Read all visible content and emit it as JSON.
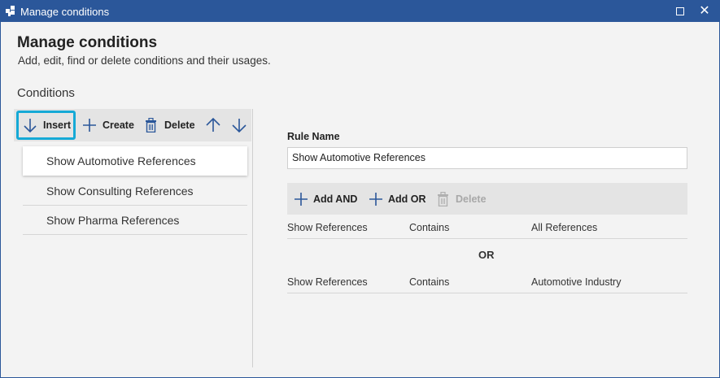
{
  "window": {
    "title": "Manage conditions",
    "controls": {
      "maximize": "maximize-icon",
      "close": "close-icon"
    }
  },
  "header": {
    "title": "Manage conditions",
    "subtitle": "Add, edit, find or delete conditions and their usages."
  },
  "conditions": {
    "section_label": "Conditions",
    "toolbar": {
      "insert_label": "Insert",
      "create_label": "Create",
      "delete_label": "Delete"
    },
    "items": [
      {
        "label": "Show Automotive References",
        "selected": true
      },
      {
        "label": "Show Consulting References",
        "selected": false
      },
      {
        "label": "Show Pharma References",
        "selected": false
      }
    ]
  },
  "rule": {
    "name_label": "Rule Name",
    "name_value": "Show Automotive References",
    "toolbar": {
      "add_and_label": "Add AND",
      "add_or_label": "Add OR",
      "delete_label": "Delete"
    },
    "groups": [
      {
        "field": "Show References",
        "operator": "Contains",
        "value": "All References"
      },
      {
        "field": "Show References",
        "operator": "Contains",
        "value": "Automotive Industry"
      }
    ],
    "or_separator": "OR"
  },
  "colors": {
    "titlebar": "#2b579a",
    "highlight_border": "#15a9d6",
    "icon_blue": "#2b579a",
    "toolbar_bg": "#e4e4e4",
    "window_bg": "#f3f3f3"
  }
}
